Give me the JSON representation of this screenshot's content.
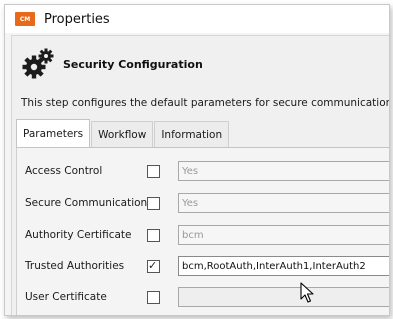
{
  "window": {
    "title": "Properties",
    "app_badge": "CM"
  },
  "header": {
    "title": "Security Configuration",
    "icon": "gears-icon",
    "description": "This step configures the default parameters for secure communication betw"
  },
  "tabs": [
    {
      "label": "Parameters",
      "active": true
    },
    {
      "label": "Workflow",
      "active": false
    },
    {
      "label": "Information",
      "active": false
    }
  ],
  "rows": [
    {
      "label": "Access Control",
      "checked": false,
      "value": "Yes",
      "editable": false
    },
    {
      "label": "Secure Communication",
      "checked": false,
      "value": "Yes",
      "editable": false
    },
    {
      "label": "Authority Certificate",
      "checked": false,
      "value": "bcm",
      "editable": false
    },
    {
      "label": "Trusted Authorities",
      "checked": true,
      "value": "bcm,RootAuth,InterAuth1,InterAuth2",
      "editable": true
    },
    {
      "label": "User Certificate",
      "checked": false,
      "value": "",
      "editable": false
    }
  ],
  "colors": {
    "badge": "#e8691a",
    "panel": "#f4f4f4"
  }
}
